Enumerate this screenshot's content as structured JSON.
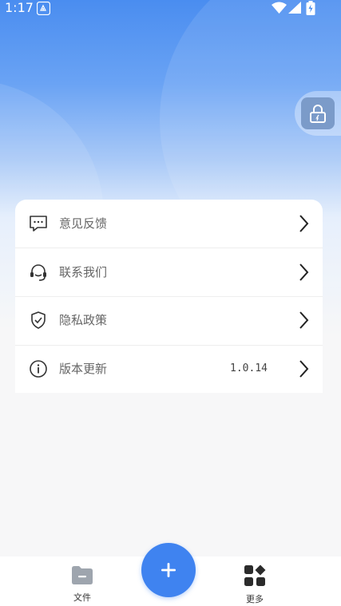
{
  "status_bar": {
    "time": "1:17"
  },
  "menu": [
    {
      "id": "feedback",
      "label": "意见反馈",
      "icon": "chat-bubble-icon",
      "value": ""
    },
    {
      "id": "contact",
      "label": "联系我们",
      "icon": "headset-icon",
      "value": ""
    },
    {
      "id": "privacy",
      "label": "隐私政策",
      "icon": "shield-check-icon",
      "value": ""
    },
    {
      "id": "version",
      "label": "版本更新",
      "icon": "info-icon",
      "value": "1.0.14"
    }
  ],
  "bottom_nav": {
    "files_label": "文件",
    "more_label": "更多",
    "add_icon": "plus-icon"
  },
  "colors": {
    "accent": "#3f83f0",
    "hero_top": "#4a8df0",
    "background": "#f7f7f8"
  }
}
